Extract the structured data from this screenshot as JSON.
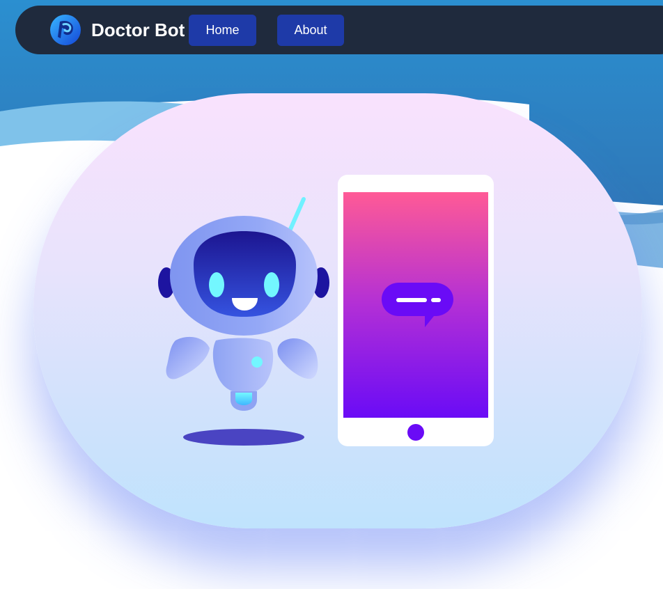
{
  "navbar": {
    "brand": "Doctor Bot",
    "logo_icon": "doctor-bot-logo-icon",
    "links": [
      {
        "label": "Home"
      },
      {
        "label": "About"
      }
    ]
  },
  "hero": {
    "illustration_icons": [
      "robot-icon",
      "smartphone-icon",
      "chat-bubble-icon"
    ]
  },
  "colors": {
    "navbar_bg": "#1f2a3d",
    "nav_button": "#1e3aa8",
    "wave_blue": "#2f82c4",
    "phone_gradient_top": "#ff5a96",
    "phone_gradient_bottom": "#6a0bf6",
    "robot_visor": "#2a1fa0",
    "robot_eyes": "#73f7ff"
  }
}
